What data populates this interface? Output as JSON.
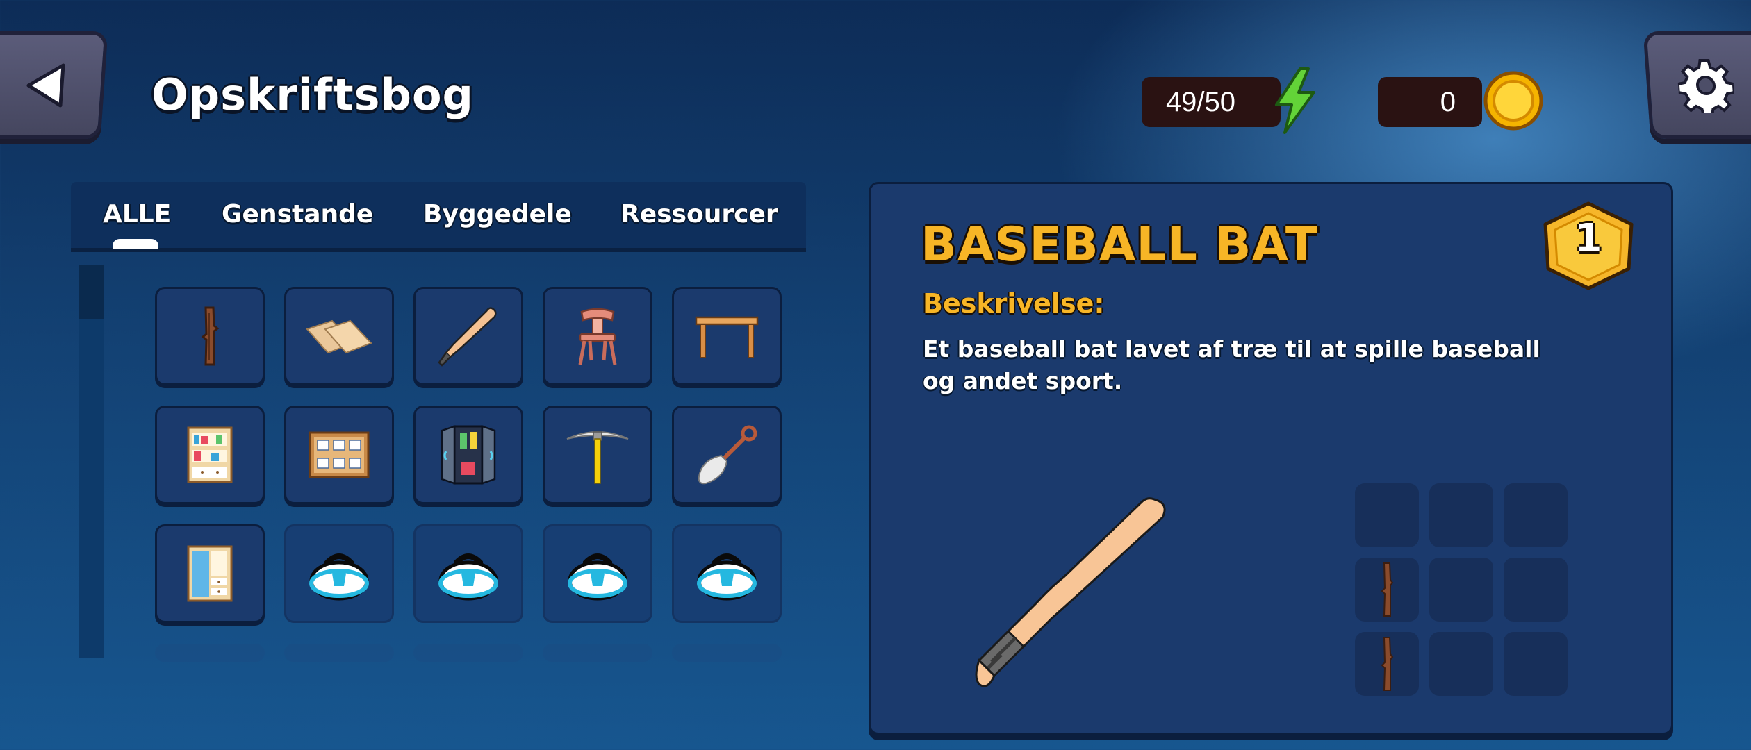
{
  "header": {
    "title": "Opskriftsbog",
    "energy": "49/50",
    "coins": "0"
  },
  "tabs": [
    {
      "label": "ALLE",
      "active": true
    },
    {
      "label": "Genstande",
      "active": false
    },
    {
      "label": "Byggedele",
      "active": false
    },
    {
      "label": "Ressourcer",
      "active": false
    }
  ],
  "recipes": [
    {
      "item": "log",
      "locked": false
    },
    {
      "item": "planks",
      "locked": false
    },
    {
      "item": "baseball-bat",
      "locked": false
    },
    {
      "item": "chair",
      "locked": false
    },
    {
      "item": "table",
      "locked": false
    },
    {
      "item": "bookshelf",
      "locked": false
    },
    {
      "item": "cork-board",
      "locked": false
    },
    {
      "item": "locker",
      "locked": false
    },
    {
      "item": "pickaxe",
      "locked": false
    },
    {
      "item": "shovel",
      "locked": false
    },
    {
      "item": "wardrobe",
      "locked": false
    },
    {
      "item": "lock",
      "locked": true
    },
    {
      "item": "lock",
      "locked": true
    },
    {
      "item": "lock",
      "locked": true
    },
    {
      "item": "lock",
      "locked": true
    }
  ],
  "detail": {
    "name": "BASEBALL BAT",
    "level": "1",
    "description_label": "Beskrivelse:",
    "description": "Et baseball bat lavet af træ til at spille baseball og andet sport.",
    "recipe_grid": [
      "",
      "",
      "",
      "log",
      "",
      "",
      "log",
      "",
      ""
    ]
  },
  "colors": {
    "accent": "#f7b526",
    "panel": "#1b3a6d",
    "energy": "#63d338",
    "coin": "#f5b400"
  }
}
